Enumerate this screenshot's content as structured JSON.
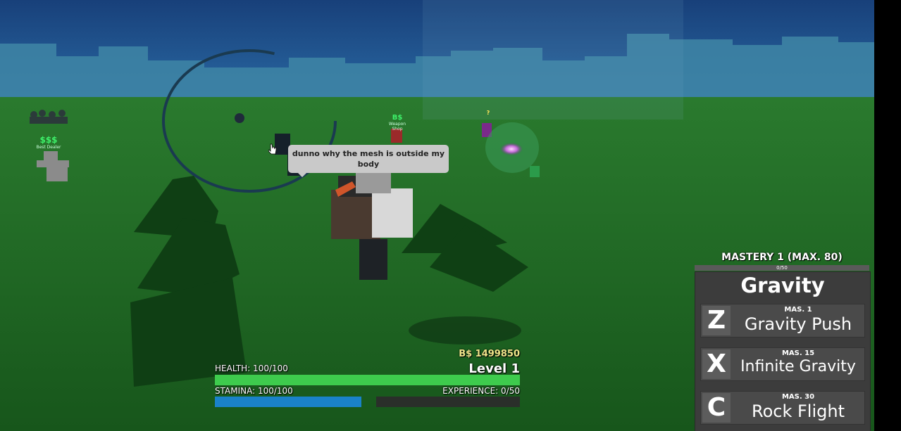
{
  "scene": {
    "chat_bubble": "dunno why the mesh is outside my body",
    "overhead_tags": [
      {
        "id": "dealer",
        "top": "$$$",
        "sub": "Best Dealer"
      },
      {
        "id": "player-2",
        "top": "B$",
        "sub": "Weapon Shop"
      },
      {
        "id": "player-3",
        "top": "?",
        "sub": ""
      }
    ],
    "colors": {
      "sky": "#1b4c86",
      "grass": "#1f6a24",
      "bubble": "#c9c9c9"
    }
  },
  "hud": {
    "money": "B$ 1499850",
    "level": "Level 1",
    "health_label": "HEALTH: 100/100",
    "health_fraction": 1.0,
    "stamina_label": "STAMINA: 100/100",
    "stamina_fraction": 1.0,
    "experience_label": "EXPERIENCE: 0/50",
    "experience_fraction": 0.0,
    "colors": {
      "health": "#3ecb4d",
      "stamina": "#1a82c9"
    }
  },
  "moves_panel": {
    "mastery_title": "MASTERY 1 (MAX. 80)",
    "mastery_progress": "0/50",
    "title": "Gravity",
    "moves": [
      {
        "key": "Z",
        "requirement": "MAS. 1",
        "name": "Gravity Push"
      },
      {
        "key": "X",
        "requirement": "MAS. 15",
        "name": "Infinite Gravity"
      },
      {
        "key": "C",
        "requirement": "MAS. 30",
        "name": "Rock Flight"
      }
    ]
  }
}
